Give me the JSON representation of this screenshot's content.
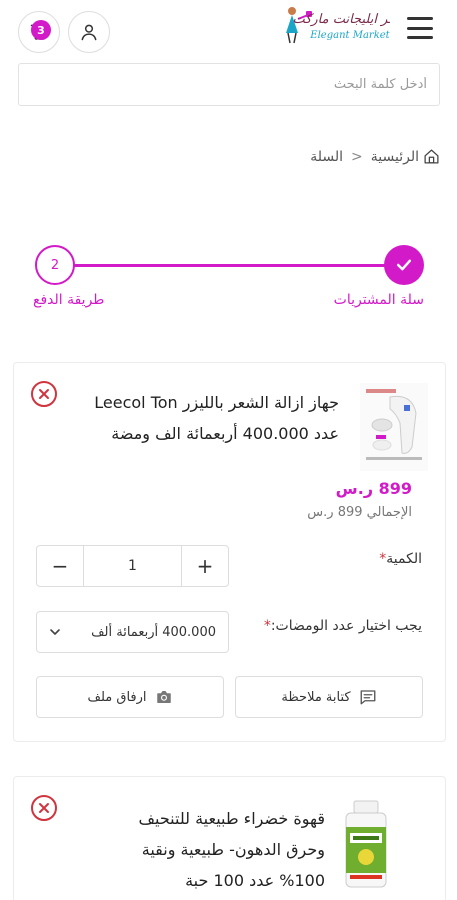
{
  "header": {
    "cart_count": "3",
    "logo_brand": "متجر ايليجانت ماركت",
    "logo_sub": "Elegant Market"
  },
  "search": {
    "placeholder": "أدخل كلمة البحث"
  },
  "breadcrumb": {
    "home": "الرئيسية",
    "current": "السلة"
  },
  "stepper": {
    "step1_label": "سلة المشتريات",
    "step2_number": "2",
    "step2_label": "طريقة الدفع"
  },
  "cart_items": [
    {
      "title": "جهاز ازالة الشعر بالليزر Leecol Ton عدد 400.000 أربعمائة الف ومضة",
      "price": "899 ر.س",
      "total": "الإجمالي 899 ر.س",
      "qty_label": "الكمية",
      "qty_value": "1",
      "qty_minus": "−",
      "qty_plus": "+",
      "flash_label": "يجب اختيار عدد الومضات:",
      "flash_value": "400.000 أربعمائة ألف",
      "note_button": "كتابة ملاحظة",
      "attach_button": "ارفاق ملف"
    },
    {
      "title": "قهوة خضراء طبيعية للتنحيف وحرق الدهون- طبيعية ونقية 100% عدد 100 حبة"
    }
  ],
  "colors": {
    "accent": "#d31ac8",
    "remove": "#d0343e"
  }
}
